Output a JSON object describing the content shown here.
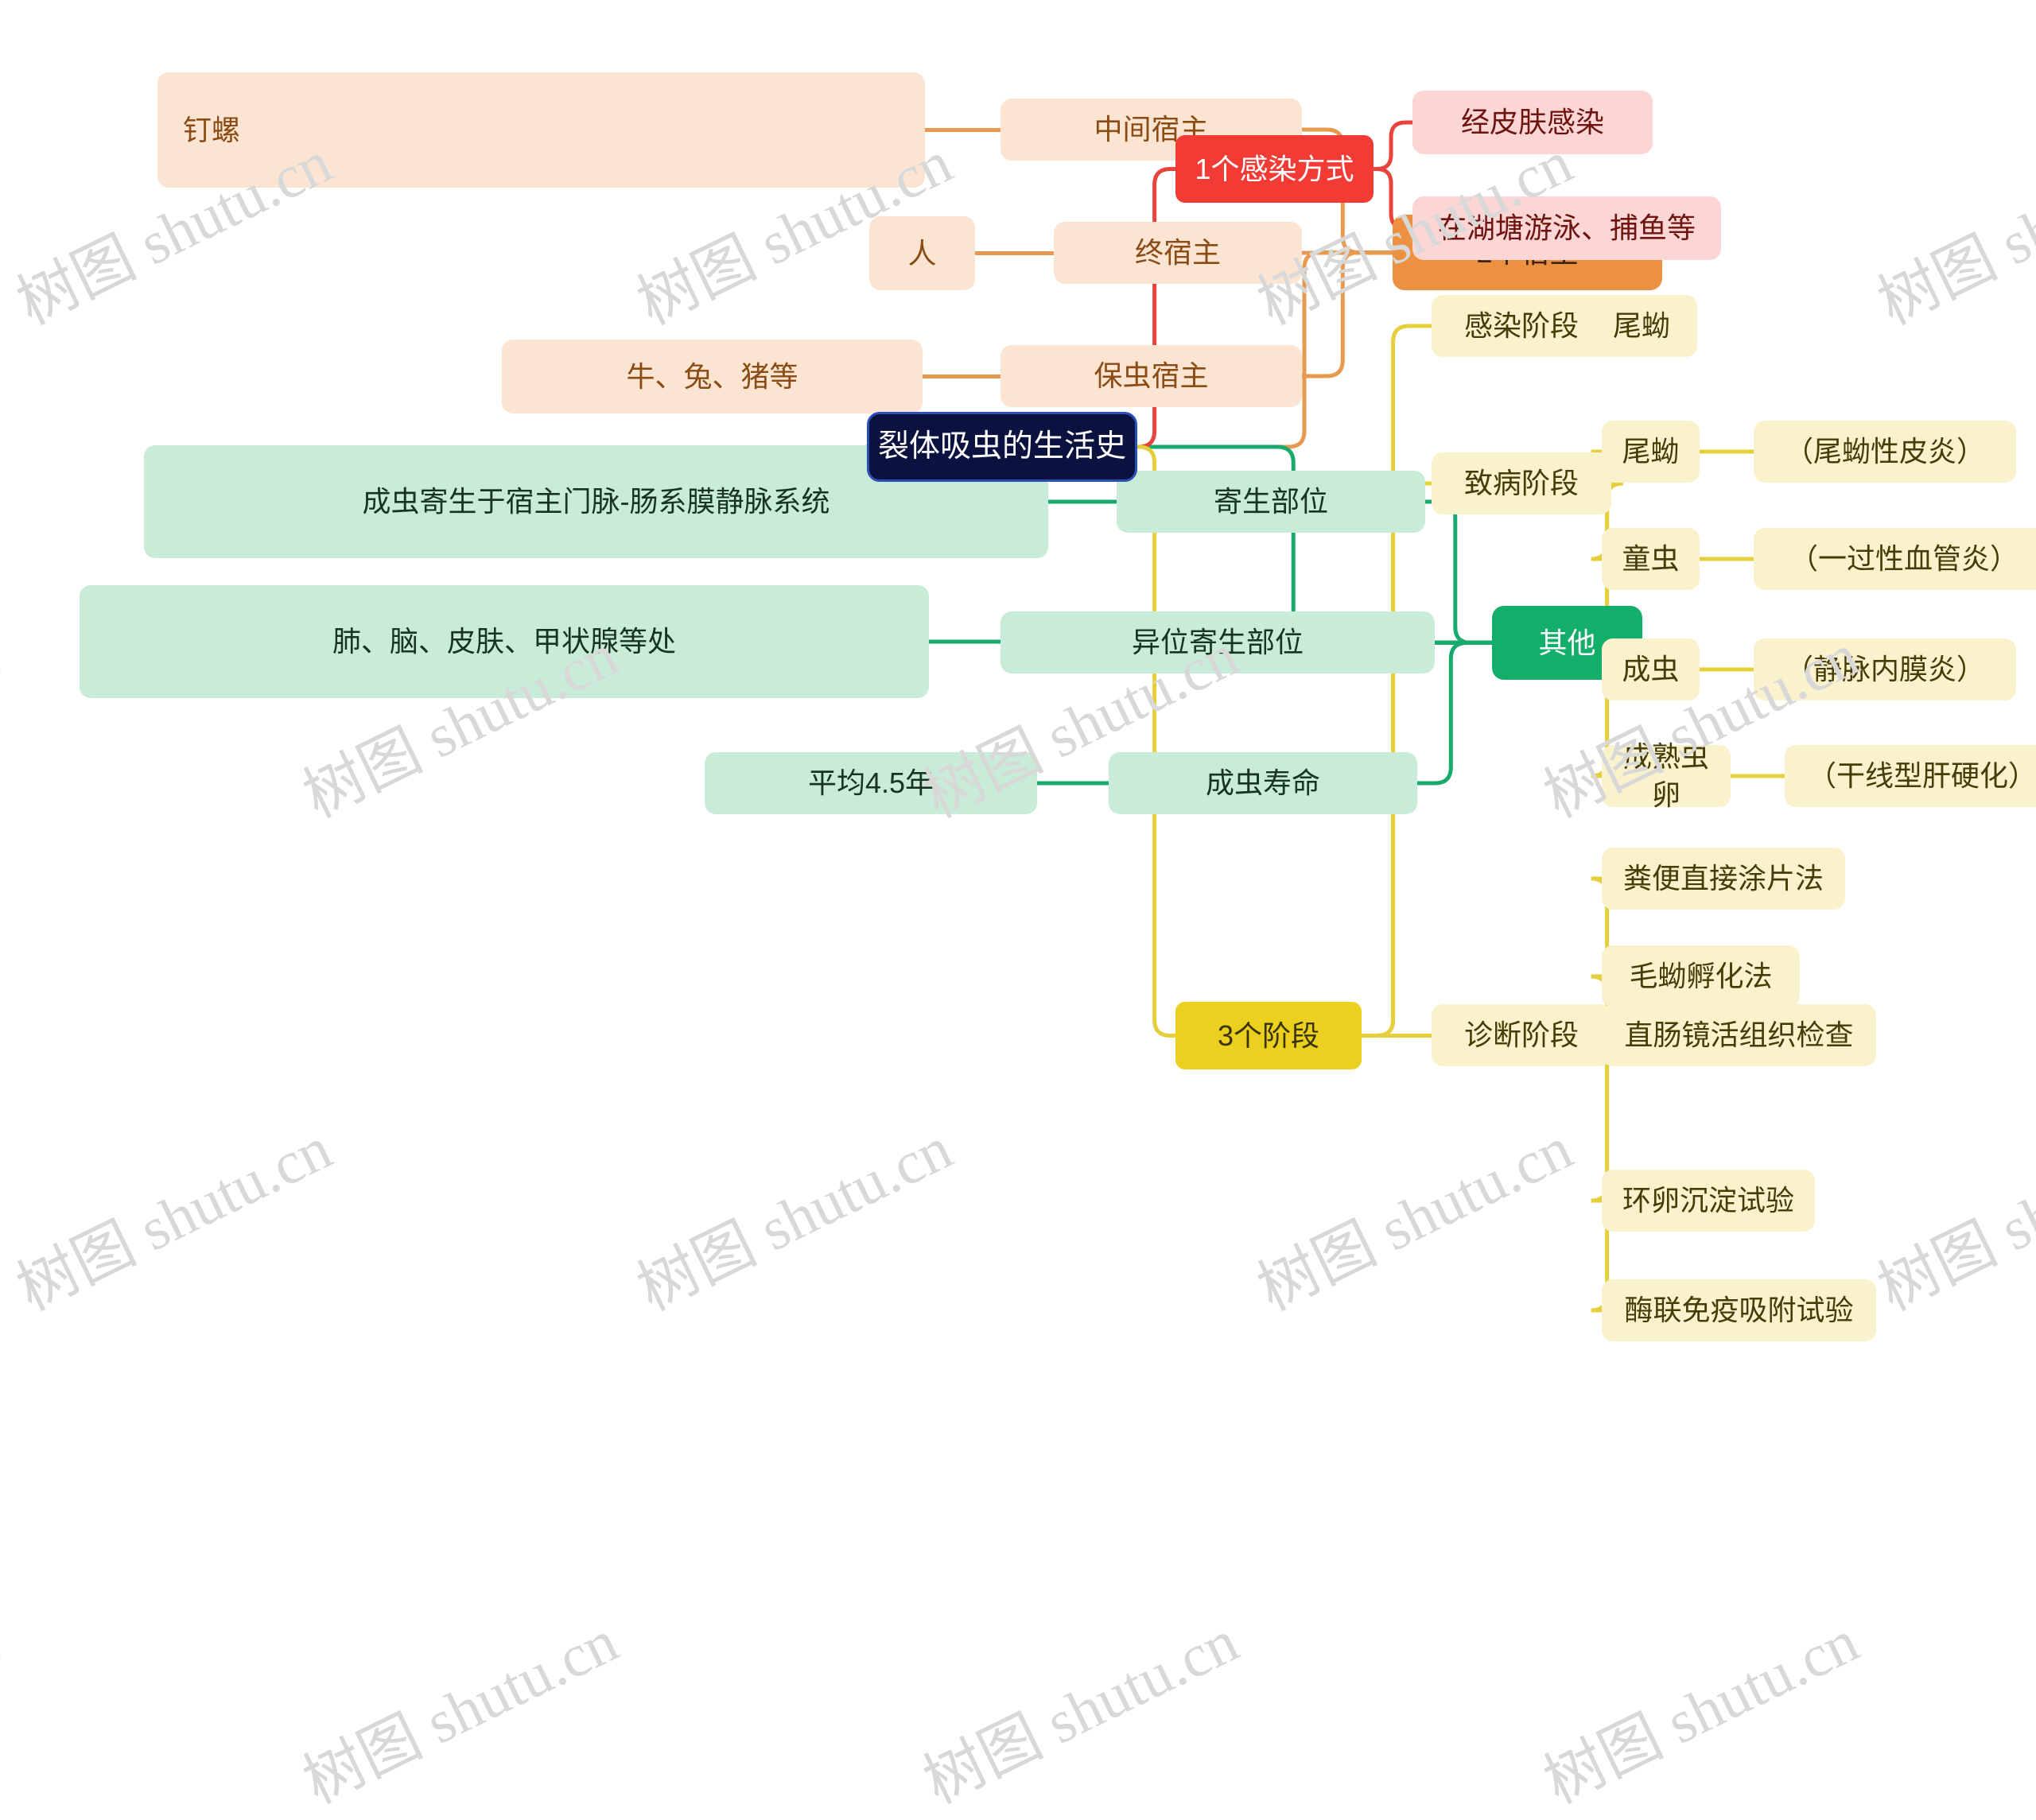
{
  "diagram": {
    "title": "裂体吸虫的生活史",
    "watermark": "树图 shutu.cn",
    "colors": {
      "root_bg": "#0b1240",
      "root_border": "#2b4fb5",
      "orange_main": "#eb9141",
      "orange_sub": "#fbe5d2",
      "orange_line": "#e79a4f",
      "green_main": "#12ae6a",
      "green_sub": "#c8ecd8",
      "green_line": "#18ab6d",
      "red_main": "#f23b34",
      "red_sub": "#fbd6d4",
      "red_line": "#e8433c",
      "yellow_main": "#ebd01f",
      "yellow_sub": "#faf2cd",
      "yellow_line": "#e5cf3a"
    }
  },
  "nodes": {
    "root": "裂体吸虫的生活史",
    "hosts_branch": "2个宿主",
    "intermediate_host": "中间宿主",
    "intermediate_host_detail": "钉螺",
    "final_host": "终宿主",
    "final_host_detail": "人",
    "reservoir_host": "保虫宿主",
    "reservoir_host_detail": "牛、兔、猪等",
    "other_branch": "其他",
    "parasitic_site": "寄生部位",
    "parasitic_site_detail": "成虫寄生于宿主门脉-肠系膜静脉系统",
    "ectopic_site": "异位寄生部位",
    "ectopic_site_detail": "肺、脑、皮肤、甲状腺等处",
    "adult_lifespan": "成虫寿命",
    "adult_lifespan_detail": "平均4.5年",
    "infection_branch": "1个感染方式",
    "infection_route_1": "经皮肤感染",
    "infection_route_2": "在湖塘游泳、捕鱼等",
    "stages_branch": "3个阶段",
    "infective_stage": "感染阶段",
    "infective_stage_detail": "尾蚴",
    "pathogenic_stage": "致病阶段",
    "pathogenic_items": [
      {
        "agent": "尾蚴",
        "effect": "（尾蚴性皮炎）"
      },
      {
        "agent": "童虫",
        "effect": "（一过性血管炎）"
      },
      {
        "agent": "成虫",
        "effect": "（静脉内膜炎）"
      },
      {
        "agent": "成熟虫卵",
        "effect": "（干线型肝硬化）"
      }
    ],
    "diagnostic_stage": "诊断阶段",
    "diagnostic_items": [
      "粪便直接涂片法",
      "毛蚴孵化法",
      "直肠镜活组织检查",
      "环卵沉淀试验",
      "酶联免疫吸附试验"
    ]
  }
}
